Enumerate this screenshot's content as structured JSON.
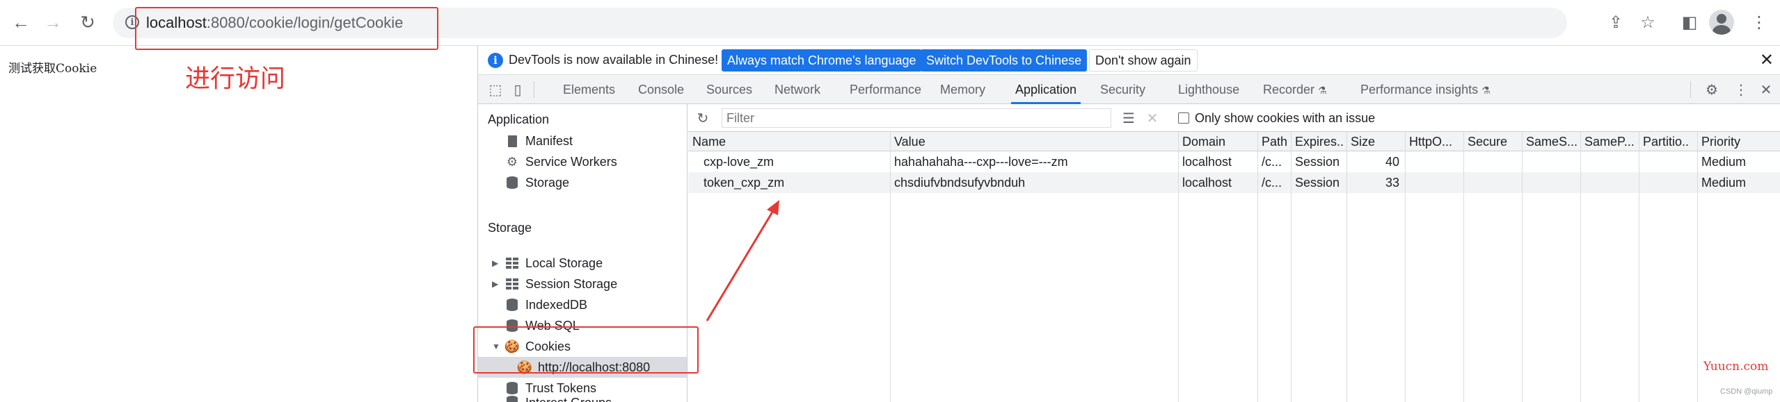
{
  "browser": {
    "url_host": "localhost",
    "url_rest": ":8080/cookie/login/getCookie"
  },
  "annotations": {
    "visit_label": "进行访问"
  },
  "page": {
    "text": "测试获取Cookie"
  },
  "devtools": {
    "infobar": {
      "message": "DevTools is now available in Chinese!",
      "btn_match": "Always match Chrome's language",
      "btn_switch": "Switch DevTools to Chinese",
      "btn_dont_show": "Don't show again"
    },
    "tabs": [
      "Elements",
      "Console",
      "Sources",
      "Network",
      "Performance",
      "Memory",
      "Application",
      "Security",
      "Lighthouse",
      "Recorder",
      "Performance insights"
    ],
    "active_tab": "Application",
    "sidebar": {
      "application_title": "Application",
      "application_items": [
        "Manifest",
        "Service Workers",
        "Storage"
      ],
      "storage_title": "Storage",
      "storage_items": [
        "Local Storage",
        "Session Storage",
        "IndexedDB",
        "Web SQL",
        "Cookies",
        "http://localhost:8080",
        "Trust Tokens",
        "Interest Groups"
      ]
    },
    "filter_placeholder": "Filter",
    "only_issue_label": "Only show cookies with an issue",
    "columns": [
      "Name",
      "Value",
      "Domain",
      "Path",
      "Expires..",
      "Size",
      "HttpO...",
      "Secure",
      "SameS...",
      "SameP...",
      "Partitio..",
      "Priority"
    ],
    "rows": [
      [
        "cxp-love_zm",
        "hahahahaha---cxp---love=---zm",
        "localhost",
        "/c...",
        "Session",
        "40",
        "",
        "",
        "",
        "",
        "",
        "Medium"
      ],
      [
        "token_cxp_zm",
        "chsdiufvbndsufyvbnduh",
        "localhost",
        "/c...",
        "Session",
        "33",
        "",
        "",
        "",
        "",
        "",
        "Medium"
      ]
    ]
  },
  "watermark": {
    "site": "Yuucn.com",
    "credit": "CSDN @qiump"
  },
  "colors": {
    "accent": "#1a73e8",
    "annotation": "#e53935"
  }
}
